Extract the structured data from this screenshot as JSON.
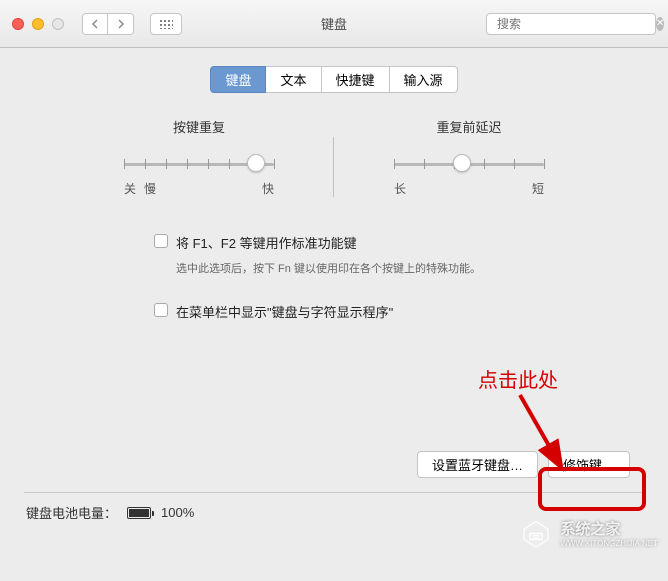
{
  "titlebar": {
    "title": "键盘",
    "search_placeholder": "搜索"
  },
  "tabs": [
    {
      "label": "键盘",
      "active": true
    },
    {
      "label": "文本",
      "active": false
    },
    {
      "label": "快捷键",
      "active": false
    },
    {
      "label": "输入源",
      "active": false
    }
  ],
  "sliders": {
    "repeat": {
      "label": "按键重复",
      "left_off": "关",
      "left_slow": "慢",
      "right": "快",
      "pos_pct": 88
    },
    "delay": {
      "label": "重复前延迟",
      "left": "长",
      "right": "短",
      "pos_pct": 45
    }
  },
  "checkbox1": {
    "label": "将 F1、F2 等键用作标准功能键",
    "desc": "选中此选项后，按下 Fn 键以使用印在各个按键上的特殊功能。"
  },
  "checkbox2": {
    "label": "在菜单栏中显示\"键盘与字符显示程序\""
  },
  "buttons": {
    "bluetooth": "设置蓝牙键盘…",
    "modifier": "修饰键…"
  },
  "battery": {
    "label": "键盘电池电量：",
    "pct": "100%"
  },
  "annotation": {
    "text": "点击此处"
  },
  "watermark": {
    "name": "系统之家",
    "url": "WWW.XITONGZHIJIA.NET"
  }
}
